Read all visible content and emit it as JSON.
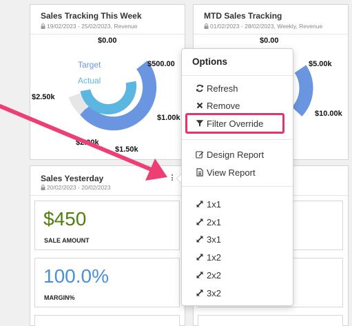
{
  "cards": {
    "week": {
      "title": "Sales Tracking This Week",
      "subtitle": "19/02/2023 - 25/02/2023, Revenue",
      "labels": {
        "top": "$0.00",
        "right_top": "$500.00",
        "left": "$2.50k",
        "right": "$1.00k",
        "bottom_left": "$2.00k",
        "bottom": "$1.50k"
      },
      "legend": {
        "target": "Target",
        "actual": "Actual"
      }
    },
    "mtd": {
      "title": "MTD Sales Tracking",
      "subtitle": "01/02/2023 - 28/02/2023, Weekly, Revenue",
      "labels": {
        "top": "$0.00",
        "right_top": "$5.00k",
        "right": "$10.00k"
      }
    },
    "yesterday": {
      "title": "Sales Yesterday",
      "subtitle": "20/02/2023 - 20/02/2023",
      "kpis": [
        {
          "value": "$450",
          "caption": "SALE AMOUNT"
        },
        {
          "value": "100.0%",
          "caption": "MARGIN%"
        }
      ]
    }
  },
  "menu": {
    "title": "Options",
    "items": [
      {
        "label": "Refresh",
        "icon": "refresh-icon"
      },
      {
        "label": "Remove",
        "icon": "close-icon"
      },
      {
        "label": "Filter Override",
        "icon": "filter-icon"
      },
      {
        "label": "Design Report",
        "icon": "edit-icon"
      },
      {
        "label": "View Report",
        "icon": "document-icon"
      },
      {
        "label": "1x1",
        "icon": "expand-icon"
      },
      {
        "label": "2x1",
        "icon": "expand-icon"
      },
      {
        "label": "3x1",
        "icon": "expand-icon"
      },
      {
        "label": "1x2",
        "icon": "expand-icon"
      },
      {
        "label": "2x2",
        "icon": "expand-icon"
      },
      {
        "label": "3x2",
        "icon": "expand-icon"
      }
    ]
  },
  "colors": {
    "target_ring": "#6a95e0",
    "actual_ring": "#5bb7e0",
    "track": "#e6e6e6",
    "kpi_green": "#4d7f0e",
    "kpi_blue": "#4a90d9",
    "highlight": "#e8336a",
    "annotation_arrow": "#ee3f74"
  },
  "chart_data": [
    {
      "type": "radial-bar",
      "title": "Sales Tracking This Week",
      "series": [
        {
          "name": "Target",
          "value": 2500
        },
        {
          "name": "Actual",
          "value": 2000
        }
      ],
      "tick_labels": [
        "$0.00",
        "$500.00",
        "$1.00k",
        "$1.50k",
        "$2.00k",
        "$2.50k"
      ]
    },
    {
      "type": "radial-bar",
      "title": "MTD Sales Tracking",
      "tick_labels": [
        "$0.00",
        "$5.00k",
        "$10.00k"
      ]
    }
  ]
}
